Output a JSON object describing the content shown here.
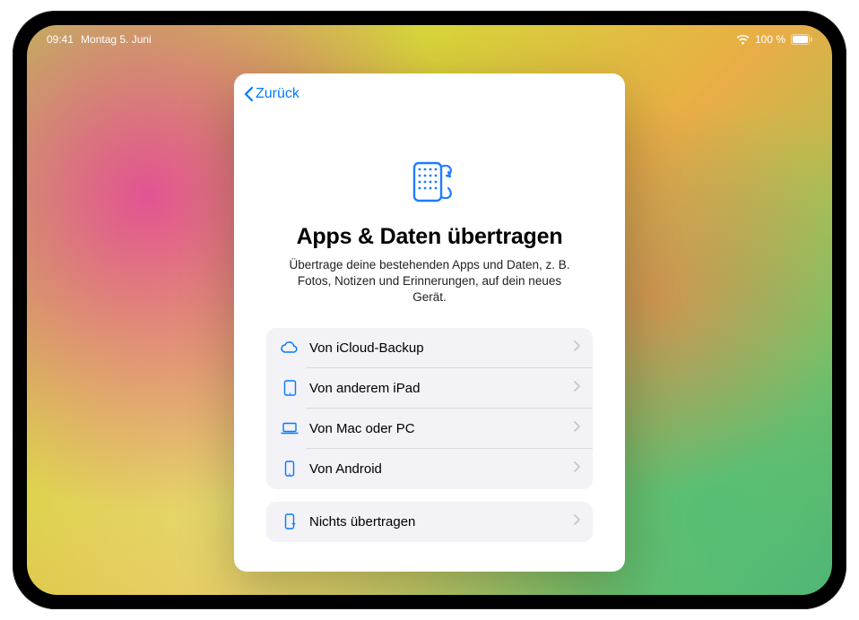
{
  "status": {
    "time": "09:41",
    "date": "Montag 5. Juni",
    "battery_text": "100 %"
  },
  "modal": {
    "back_label": "Zurück",
    "title": "Apps & Daten übertragen",
    "subtitle": "Übertrage deine bestehenden Apps und Daten, z. B. Fotos, Notizen und Erinnerungen, auf dein neues Gerät.",
    "options": [
      {
        "icon": "cloud",
        "label": "Von iCloud-Backup"
      },
      {
        "icon": "ipad",
        "label": "Von anderem iPad"
      },
      {
        "icon": "laptop",
        "label": "Von Mac oder PC"
      },
      {
        "icon": "phone",
        "label": "Von Android"
      }
    ],
    "secondary": {
      "icon": "phone-sparkle",
      "label": "Nichts übertragen"
    }
  }
}
